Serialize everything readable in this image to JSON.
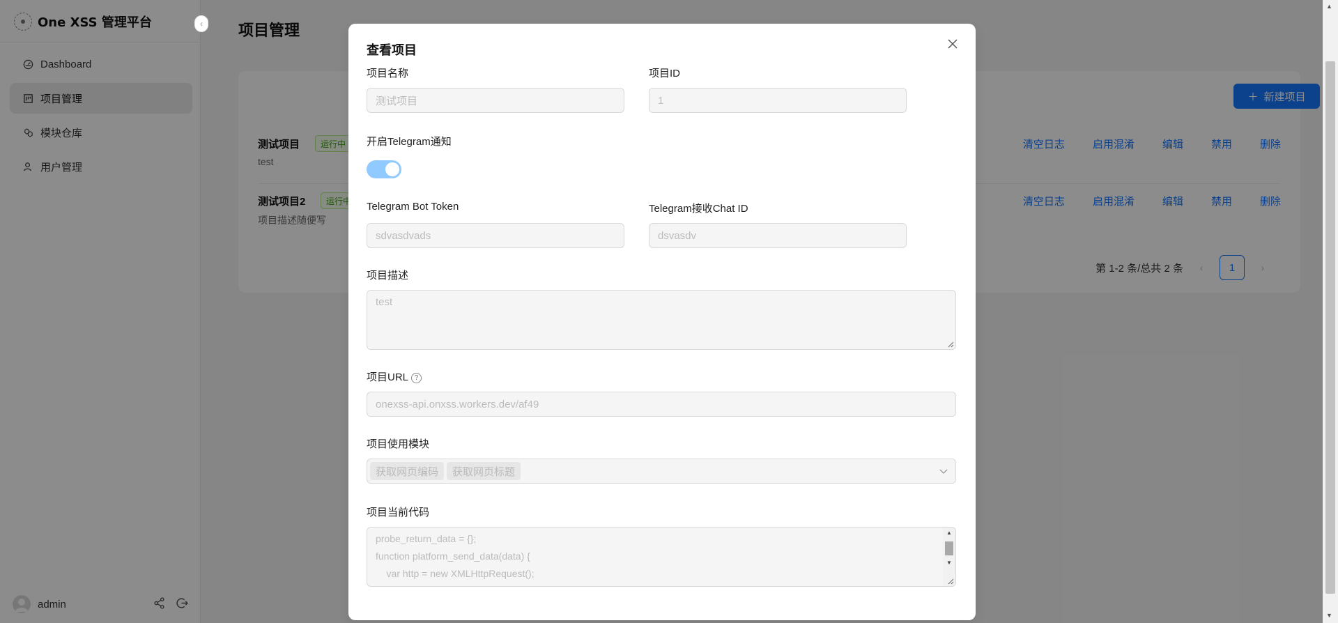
{
  "sidebar": {
    "brand": "One XSS 管理平台",
    "items": [
      {
        "label": "Dashboard",
        "icon": "dashboard-icon"
      },
      {
        "label": "项目管理",
        "icon": "project-icon"
      },
      {
        "label": "模块仓库",
        "icon": "module-icon"
      },
      {
        "label": "用户管理",
        "icon": "user-icon"
      }
    ],
    "username": "admin"
  },
  "page": {
    "title": "项目管理",
    "new_button": "新建项目",
    "projects": [
      {
        "name": "测试项目",
        "status": "运行中",
        "description": "test",
        "actions": [
          "清空日志",
          "启用混淆",
          "编辑",
          "禁用",
          "删除"
        ]
      },
      {
        "name": "测试项目2",
        "status": "运行中",
        "description": "项目描述随便写",
        "actions": [
          "清空日志",
          "启用混淆",
          "编辑",
          "禁用",
          "删除"
        ]
      }
    ],
    "pagination": {
      "summary": "第 1-2 条/总共 2 条",
      "current": "1"
    }
  },
  "modal": {
    "title": "查看项目",
    "labels": {
      "name": "项目名称",
      "id": "项目ID",
      "telegram": "开启Telegram通知",
      "bot_token": "Telegram Bot Token",
      "chat_id": "Telegram接收Chat ID",
      "desc": "项目描述",
      "url": "项目URL",
      "modules": "项目使用模块",
      "code": "项目当前代码"
    },
    "values": {
      "name": "测试项目",
      "id": "1",
      "telegram_enabled": true,
      "bot_token": "sdvasdvads",
      "chat_id": "dsvasdv",
      "desc": "test",
      "url": "onexss-api.onxss.workers.dev/af49",
      "modules": [
        "获取网页编码",
        "获取网页标题"
      ],
      "code_lines": [
        "probe_return_data = {};",
        "function platform_send_data(data) {",
        "    var http = new XMLHttpRequest();"
      ]
    }
  },
  "colors": {
    "primary": "#1677ff",
    "tag_green": "#389e0d",
    "toggle": "#91caff"
  }
}
